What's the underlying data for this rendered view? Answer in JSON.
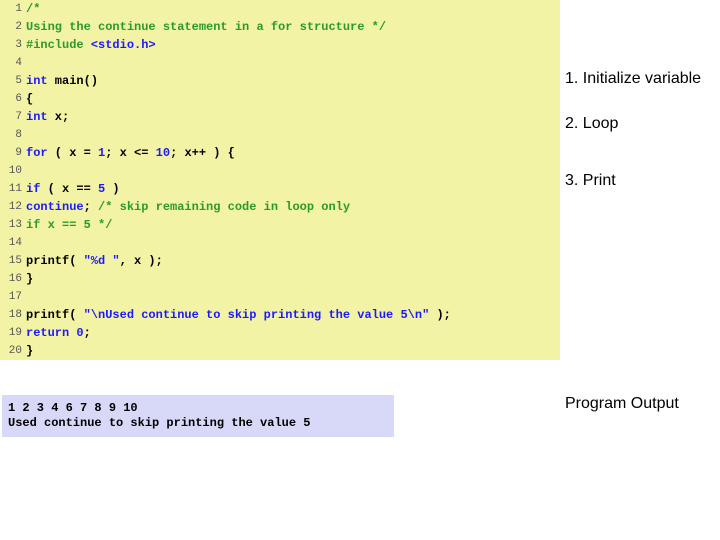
{
  "code": {
    "lines": [
      {
        "num": "1",
        "tokens": [
          {
            "cls": "tok-comment",
            "txt": "/*"
          }
        ]
      },
      {
        "num": "2",
        "tokens": [
          {
            "cls": "tok-comment",
            "txt": "   Using the continue statement in a for structure */"
          }
        ]
      },
      {
        "num": "3",
        "tokens": [
          {
            "cls": "tok-pp",
            "txt": "#include "
          },
          {
            "cls": "tok-kw",
            "txt": "<stdio.h>"
          }
        ]
      },
      {
        "num": "4",
        "tokens": [
          {
            "cls": "tok-plain",
            "txt": " "
          }
        ]
      },
      {
        "num": "5",
        "tokens": [
          {
            "cls": "tok-kw",
            "txt": "int"
          },
          {
            "cls": "tok-plain",
            "txt": " main()"
          }
        ]
      },
      {
        "num": "6",
        "tokens": [
          {
            "cls": "tok-plain",
            "txt": "{"
          }
        ]
      },
      {
        "num": "7",
        "tokens": [
          {
            "cls": "tok-plain",
            "txt": "   "
          },
          {
            "cls": "tok-kw",
            "txt": "int"
          },
          {
            "cls": "tok-plain",
            "txt": " x;"
          }
        ]
      },
      {
        "num": "8",
        "tokens": [
          {
            "cls": "tok-plain",
            "txt": " "
          }
        ]
      },
      {
        "num": "9",
        "tokens": [
          {
            "cls": "tok-plain",
            "txt": "   "
          },
          {
            "cls": "tok-kw",
            "txt": "for"
          },
          {
            "cls": "tok-plain",
            "txt": " ( x = "
          },
          {
            "cls": "tok-kw",
            "txt": "1"
          },
          {
            "cls": "tok-plain",
            "txt": "; x <= "
          },
          {
            "cls": "tok-kw",
            "txt": "10"
          },
          {
            "cls": "tok-plain",
            "txt": "; x++ ) {"
          }
        ]
      },
      {
        "num": "10",
        "tokens": [
          {
            "cls": "tok-plain",
            "txt": " "
          }
        ]
      },
      {
        "num": "11",
        "tokens": [
          {
            "cls": "tok-plain",
            "txt": "      "
          },
          {
            "cls": "tok-kw",
            "txt": "if"
          },
          {
            "cls": "tok-plain",
            "txt": " ( x == "
          },
          {
            "cls": "tok-kw",
            "txt": "5"
          },
          {
            "cls": "tok-plain",
            "txt": " )"
          }
        ]
      },
      {
        "num": "12",
        "tokens": [
          {
            "cls": "tok-plain",
            "txt": "         "
          },
          {
            "cls": "tok-kw",
            "txt": "continue"
          },
          {
            "cls": "tok-plain",
            "txt": ";  "
          },
          {
            "cls": "tok-comment",
            "txt": "/* skip remaining code in loop only"
          }
        ]
      },
      {
        "num": "13",
        "tokens": [
          {
            "cls": "tok-comment",
            "txt": "                       if x == 5 */"
          }
        ]
      },
      {
        "num": "14",
        "tokens": [
          {
            "cls": "tok-plain",
            "txt": " "
          }
        ]
      },
      {
        "num": "15",
        "tokens": [
          {
            "cls": "tok-plain",
            "txt": "       printf( "
          },
          {
            "cls": "tok-kw",
            "txt": "\"%d \""
          },
          {
            "cls": "tok-plain",
            "txt": ", x );"
          }
        ]
      },
      {
        "num": "16",
        "tokens": [
          {
            "cls": "tok-plain",
            "txt": "   }"
          }
        ]
      },
      {
        "num": "17",
        "tokens": [
          {
            "cls": "tok-plain",
            "txt": " "
          }
        ]
      },
      {
        "num": "18",
        "tokens": [
          {
            "cls": "tok-plain",
            "txt": "   printf( "
          },
          {
            "cls": "tok-kw",
            "txt": "\"\\nUsed continue to skip printing the value 5\\n\""
          },
          {
            "cls": "tok-plain",
            "txt": " );"
          }
        ]
      },
      {
        "num": "19",
        "tokens": [
          {
            "cls": "tok-plain",
            "txt": "   "
          },
          {
            "cls": "tok-kw",
            "txt": "return"
          },
          {
            "cls": "tok-plain",
            "txt": " "
          },
          {
            "cls": "tok-kw",
            "txt": "0"
          },
          {
            "cls": "tok-plain",
            "txt": ";"
          }
        ]
      },
      {
        "num": "20",
        "tokens": [
          {
            "cls": "tok-plain",
            "txt": "}"
          }
        ]
      }
    ]
  },
  "annotations": {
    "a1": "1. Initialize variable",
    "a2": "2. Loop",
    "a3": "3. Print",
    "output_label": "Program Output"
  },
  "output": "1 2 3 4 6 7 8 9 10\nUsed continue to skip printing the value 5"
}
